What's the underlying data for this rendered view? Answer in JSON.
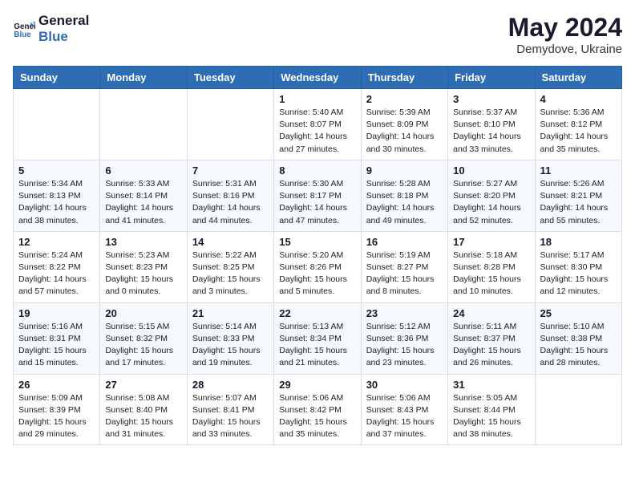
{
  "logo": {
    "line1": "General",
    "line2": "Blue"
  },
  "title": "May 2024",
  "location": "Demydove, Ukraine",
  "days_header": [
    "Sunday",
    "Monday",
    "Tuesday",
    "Wednesday",
    "Thursday",
    "Friday",
    "Saturday"
  ],
  "weeks": [
    [
      {
        "day": "",
        "info": ""
      },
      {
        "day": "",
        "info": ""
      },
      {
        "day": "",
        "info": ""
      },
      {
        "day": "1",
        "info": "Sunrise: 5:40 AM\nSunset: 8:07 PM\nDaylight: 14 hours\nand 27 minutes."
      },
      {
        "day": "2",
        "info": "Sunrise: 5:39 AM\nSunset: 8:09 PM\nDaylight: 14 hours\nand 30 minutes."
      },
      {
        "day": "3",
        "info": "Sunrise: 5:37 AM\nSunset: 8:10 PM\nDaylight: 14 hours\nand 33 minutes."
      },
      {
        "day": "4",
        "info": "Sunrise: 5:36 AM\nSunset: 8:12 PM\nDaylight: 14 hours\nand 35 minutes."
      }
    ],
    [
      {
        "day": "5",
        "info": "Sunrise: 5:34 AM\nSunset: 8:13 PM\nDaylight: 14 hours\nand 38 minutes."
      },
      {
        "day": "6",
        "info": "Sunrise: 5:33 AM\nSunset: 8:14 PM\nDaylight: 14 hours\nand 41 minutes."
      },
      {
        "day": "7",
        "info": "Sunrise: 5:31 AM\nSunset: 8:16 PM\nDaylight: 14 hours\nand 44 minutes."
      },
      {
        "day": "8",
        "info": "Sunrise: 5:30 AM\nSunset: 8:17 PM\nDaylight: 14 hours\nand 47 minutes."
      },
      {
        "day": "9",
        "info": "Sunrise: 5:28 AM\nSunset: 8:18 PM\nDaylight: 14 hours\nand 49 minutes."
      },
      {
        "day": "10",
        "info": "Sunrise: 5:27 AM\nSunset: 8:20 PM\nDaylight: 14 hours\nand 52 minutes."
      },
      {
        "day": "11",
        "info": "Sunrise: 5:26 AM\nSunset: 8:21 PM\nDaylight: 14 hours\nand 55 minutes."
      }
    ],
    [
      {
        "day": "12",
        "info": "Sunrise: 5:24 AM\nSunset: 8:22 PM\nDaylight: 14 hours\nand 57 minutes."
      },
      {
        "day": "13",
        "info": "Sunrise: 5:23 AM\nSunset: 8:23 PM\nDaylight: 15 hours\nand 0 minutes."
      },
      {
        "day": "14",
        "info": "Sunrise: 5:22 AM\nSunset: 8:25 PM\nDaylight: 15 hours\nand 3 minutes."
      },
      {
        "day": "15",
        "info": "Sunrise: 5:20 AM\nSunset: 8:26 PM\nDaylight: 15 hours\nand 5 minutes."
      },
      {
        "day": "16",
        "info": "Sunrise: 5:19 AM\nSunset: 8:27 PM\nDaylight: 15 hours\nand 8 minutes."
      },
      {
        "day": "17",
        "info": "Sunrise: 5:18 AM\nSunset: 8:28 PM\nDaylight: 15 hours\nand 10 minutes."
      },
      {
        "day": "18",
        "info": "Sunrise: 5:17 AM\nSunset: 8:30 PM\nDaylight: 15 hours\nand 12 minutes."
      }
    ],
    [
      {
        "day": "19",
        "info": "Sunrise: 5:16 AM\nSunset: 8:31 PM\nDaylight: 15 hours\nand 15 minutes."
      },
      {
        "day": "20",
        "info": "Sunrise: 5:15 AM\nSunset: 8:32 PM\nDaylight: 15 hours\nand 17 minutes."
      },
      {
        "day": "21",
        "info": "Sunrise: 5:14 AM\nSunset: 8:33 PM\nDaylight: 15 hours\nand 19 minutes."
      },
      {
        "day": "22",
        "info": "Sunrise: 5:13 AM\nSunset: 8:34 PM\nDaylight: 15 hours\nand 21 minutes."
      },
      {
        "day": "23",
        "info": "Sunrise: 5:12 AM\nSunset: 8:36 PM\nDaylight: 15 hours\nand 23 minutes."
      },
      {
        "day": "24",
        "info": "Sunrise: 5:11 AM\nSunset: 8:37 PM\nDaylight: 15 hours\nand 26 minutes."
      },
      {
        "day": "25",
        "info": "Sunrise: 5:10 AM\nSunset: 8:38 PM\nDaylight: 15 hours\nand 28 minutes."
      }
    ],
    [
      {
        "day": "26",
        "info": "Sunrise: 5:09 AM\nSunset: 8:39 PM\nDaylight: 15 hours\nand 29 minutes."
      },
      {
        "day": "27",
        "info": "Sunrise: 5:08 AM\nSunset: 8:40 PM\nDaylight: 15 hours\nand 31 minutes."
      },
      {
        "day": "28",
        "info": "Sunrise: 5:07 AM\nSunset: 8:41 PM\nDaylight: 15 hours\nand 33 minutes."
      },
      {
        "day": "29",
        "info": "Sunrise: 5:06 AM\nSunset: 8:42 PM\nDaylight: 15 hours\nand 35 minutes."
      },
      {
        "day": "30",
        "info": "Sunrise: 5:06 AM\nSunset: 8:43 PM\nDaylight: 15 hours\nand 37 minutes."
      },
      {
        "day": "31",
        "info": "Sunrise: 5:05 AM\nSunset: 8:44 PM\nDaylight: 15 hours\nand 38 minutes."
      },
      {
        "day": "",
        "info": ""
      }
    ]
  ]
}
